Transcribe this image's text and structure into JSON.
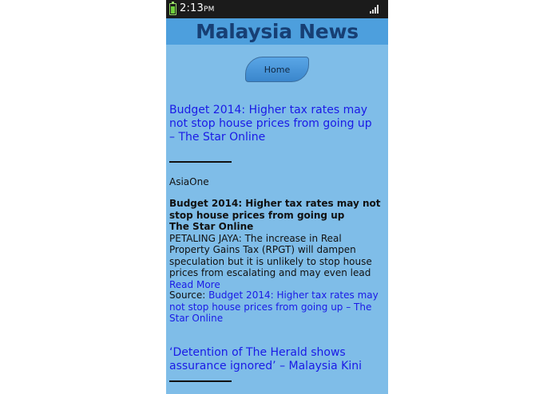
{
  "status_bar": {
    "time": "2:13",
    "ampm": "PM",
    "battery_icon": "battery-icon",
    "signal_icon": "signal-icon"
  },
  "app": {
    "title": "Malaysia News",
    "home_label": "Home"
  },
  "articles": [
    {
      "title": "Budget 2014: Higher tax rates may not stop house prices from going up – The Star Online",
      "publisher": "AsiaOne",
      "body_title": "Budget 2014: Higher tax rates may not stop house prices from going up",
      "body_source": "The Star Online",
      "snippet": "PETALING JAYA: The increase in Real Property Gains Tax (RPGT) will dampen speculation but it is unlikely to stop house prices from escalating and may even lead ",
      "read_more": "Read More",
      "source_label": "Source: ",
      "source_link": "Budget 2014: Higher tax rates may not stop house prices from going up – The Star Online"
    },
    {
      "title": "‘Detention of The Herald shows assurance ignored’ – Malaysia Kini"
    }
  ],
  "colors": {
    "background": "#7fbde8",
    "header": "#4d9fdd",
    "title": "#173f74",
    "link": "#1a1ae6"
  }
}
